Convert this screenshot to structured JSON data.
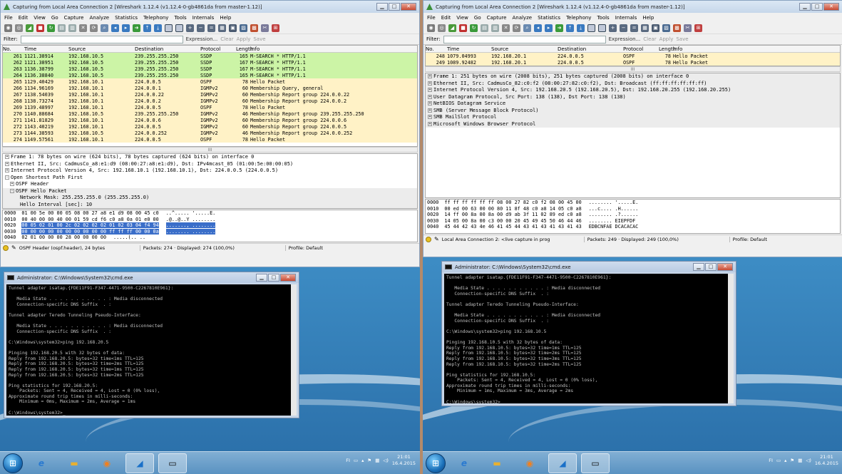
{
  "left": {
    "wireshark": {
      "title": "Capturing from Local Area Connection 2   [Wireshark 1.12.4  (v1.12.4-0-gb4861da from master-1.12)]",
      "menu": [
        "File",
        "Edit",
        "View",
        "Go",
        "Capture",
        "Analyze",
        "Statistics",
        "Telephony",
        "Tools",
        "Internals",
        "Help"
      ],
      "filter_label": "Filter:",
      "filter_actions": [
        "Expression...",
        "Clear",
        "Apply",
        "Save"
      ],
      "columns": [
        "No.",
        "Time",
        "Source",
        "Destination",
        "Protocol",
        "Length",
        "Info"
      ],
      "packets": [
        {
          "no": "261",
          "time": "1121.38914",
          "src": "192.168.10.5",
          "dst": "239.255.255.250",
          "proto": "SSDP",
          "len": "165",
          "info": "M-SEARCH * HTTP/1.1",
          "color": "#ccf4a6"
        },
        {
          "no": "262",
          "time": "1121.38951",
          "src": "192.168.10.5",
          "dst": "239.255.255.250",
          "proto": "SSDP",
          "len": "167",
          "info": "M-SEARCH * HTTP/1.1",
          "color": "#ccf4a6"
        },
        {
          "no": "263",
          "time": "1136.38799",
          "src": "192.168.10.5",
          "dst": "239.255.255.250",
          "proto": "SSDP",
          "len": "167",
          "info": "M-SEARCH * HTTP/1.1",
          "color": "#ccf4a6"
        },
        {
          "no": "264",
          "time": "1136.38840",
          "src": "192.168.10.5",
          "dst": "239.255.255.250",
          "proto": "SSDP",
          "len": "165",
          "info": "M-SEARCH * HTTP/1.1",
          "color": "#ccf4a6"
        },
        {
          "no": "265",
          "time": "1129.40429",
          "src": "192.168.10.1",
          "dst": "224.0.0.5",
          "proto": "OSPF",
          "len": "78",
          "info": "Hello Packet",
          "color": "#fff2c6"
        },
        {
          "no": "266",
          "time": "1134.96169",
          "src": "192.168.10.1",
          "dst": "224.0.0.1",
          "proto": "IGMPv2",
          "len": "60",
          "info": "Membership Query, general",
          "color": "#fff2c6"
        },
        {
          "no": "267",
          "time": "1138.54039",
          "src": "192.168.10.1",
          "dst": "224.0.0.22",
          "proto": "IGMPv2",
          "len": "60",
          "info": "Membership Report group 224.0.0.22",
          "color": "#fff2c6"
        },
        {
          "no": "268",
          "time": "1138.73274",
          "src": "192.168.10.1",
          "dst": "224.0.0.2",
          "proto": "IGMPv2",
          "len": "60",
          "info": "Membership Report group 224.0.0.2",
          "color": "#fff2c6"
        },
        {
          "no": "269",
          "time": "1139.48997",
          "src": "192.168.10.1",
          "dst": "224.0.0.5",
          "proto": "OSPF",
          "len": "78",
          "info": "Hello Packet",
          "color": "#fff2c6"
        },
        {
          "no": "270",
          "time": "1140.88684",
          "src": "192.168.10.5",
          "dst": "239.255.255.250",
          "proto": "IGMPv2",
          "len": "46",
          "info": "Membership Report group 239.255.255.250",
          "color": "#fff2c6"
        },
        {
          "no": "271",
          "time": "1141.81829",
          "src": "192.168.10.1",
          "dst": "224.0.0.6",
          "proto": "IGMPv2",
          "len": "60",
          "info": "Membership Report group 224.0.0.6",
          "color": "#fff2c6"
        },
        {
          "no": "272",
          "time": "1143.40219",
          "src": "192.168.10.1",
          "dst": "224.0.0.5",
          "proto": "IGMPv2",
          "len": "60",
          "info": "Membership Report group 224.0.0.5",
          "color": "#fff2c6"
        },
        {
          "no": "273",
          "time": "1144.38593",
          "src": "192.168.10.5",
          "dst": "224.0.0.252",
          "proto": "IGMPv2",
          "len": "46",
          "info": "Membership Report group 224.0.0.252",
          "color": "#fff2c6"
        },
        {
          "no": "274",
          "time": "1149.57561",
          "src": "192.168.10.1",
          "dst": "224.0.0.5",
          "proto": "OSPF",
          "len": "78",
          "info": "Hello Packet",
          "color": "#fff2c6"
        }
      ],
      "details": [
        {
          "text": "Frame 1: 78 bytes on wire (624 bits), 78 bytes captured (624 bits) on interface 0",
          "level": 0,
          "sign": "+"
        },
        {
          "text": "Ethernet II, Src: CadmusCo_a8:e1:d9 (08:00:27:a8:e1:d9), Dst: IPv4mcast_05 (01:00:5e:00:00:05)",
          "level": 0,
          "sign": "+"
        },
        {
          "text": "Internet Protocol Version 4, Src: 192.168.10.1 (192.168.10.1), Dst: 224.0.0.5 (224.0.0.5)",
          "level": 0,
          "sign": "+"
        },
        {
          "text": "Open Shortest Path First",
          "level": 0,
          "sign": "-"
        },
        {
          "text": "OSPF Header",
          "level": 1,
          "sign": "+"
        },
        {
          "text": "OSPF Hello Packet",
          "level": 1,
          "sign": "-"
        },
        {
          "text": "Network Mask: 255.255.255.0 (255.255.255.0)",
          "level": 2,
          "sign": ""
        },
        {
          "text": "Hello Interval [sec]: 10",
          "level": 2,
          "sign": ""
        }
      ],
      "hex": [
        {
          "off": "0000",
          "bytes": "01 00 5e 00 00 05 08 00  27 a8 e1 d9 08 00 45 c0",
          "ascii": "..^..... '.....E."
        },
        {
          "off": "0010",
          "bytes": "00 40 00 00 40 00 01 59  cd f6 c0 a8 0a 01 e0 00",
          "ascii": ".@..@..Y ........"
        },
        {
          "off": "0020",
          "bytes": "00 05 02 01 00 2c 02 02  02 02 01 02 03 04 f4 94",
          "ascii": "......., ........"
        },
        {
          "off": "0030",
          "bytes": "00 00 00 00 00 00 00 00  00 00 ff ff ff 00 00 0a",
          "ascii": "........ ........"
        },
        {
          "off": "0040",
          "bytes": "02 01 00 00 00 28 00 00  00 00",
          "ascii": ".....(.. .."
        }
      ],
      "status": {
        "field": "OSPF Header (ospf.header), 24 bytes",
        "packets": "Packets: 274 · Displayed: 274 (100,0%)",
        "profile": "Profile: Default"
      }
    },
    "cmd": {
      "title": "Administrator: C:\\Windows\\System32\\cmd.exe",
      "lines": [
        "Tunnel adapter isatap.{FDE11F91-F347-4471-9500-C2267810E961}:",
        "",
        "   Media State . . . . . . . . . . . : Media disconnected",
        "   Connection-specific DNS Suffix  . :",
        "",
        "Tunnel adapter Teredo Tunneling Pseudo-Interface:",
        "",
        "   Media State . . . . . . . . . . . : Media disconnected",
        "   Connection-specific DNS Suffix  . :",
        "",
        "C:\\Windows\\system32>ping 192.168.20.5",
        "",
        "Pinging 192.168.20.5 with 32 bytes of data:",
        "Reply from 192.168.20.5: bytes=32 time<1ms TTL=125",
        "Reply from 192.168.20.5: bytes=32 time=2ms TTL=125",
        "Reply from 192.168.20.5: bytes=32 time=1ms TTL=125",
        "Reply from 192.168.20.5: bytes=32 time=2ms TTL=125",
        "",
        "Ping statistics for 192.168.20.5:",
        "    Packets: Sent = 4, Received = 4, Lost = 0 (0% loss),",
        "Approximate round trip times in milli-seconds:",
        "    Minimum = 0ms, Maximum = 2ms, Average = 1ms",
        "",
        "C:\\Windows\\system32>_"
      ]
    },
    "clock": {
      "time": "21:01",
      "date": "16.4.2015"
    },
    "lang": "FI"
  },
  "right": {
    "wireshark": {
      "title": "Capturing from Local Area Connection 2   [Wireshark 1.12.4  (v1.12.4-0-gb4861da from master-1.12)]",
      "menu": [
        "File",
        "Edit",
        "View",
        "Go",
        "Capture",
        "Analyze",
        "Statistics",
        "Telephony",
        "Tools",
        "Internals",
        "Help"
      ],
      "filter_label": "Filter:",
      "filter_actions": [
        "Expression...",
        "Clear",
        "Apply",
        "Save"
      ],
      "columns": [
        "No.",
        "Time",
        "Source",
        "Destination",
        "Protocol",
        "Length",
        "Info"
      ],
      "packets": [
        {
          "no": "248",
          "time": "1079.04993",
          "src": "192.168.20.1",
          "dst": "224.0.0.5",
          "proto": "OSPF",
          "len": "78",
          "info": "Hello Packet",
          "color": "#fff2c6"
        },
        {
          "no": "249",
          "time": "1089.92482",
          "src": "192.168.20.1",
          "dst": "224.0.0.5",
          "proto": "OSPF",
          "len": "78",
          "info": "Hello Packet",
          "color": "#fff2c6"
        }
      ],
      "details": [
        {
          "text": "Frame 1: 251 bytes on wire (2008 bits), 251 bytes captured (2008 bits) on interface 0",
          "level": 0,
          "sign": "+"
        },
        {
          "text": "Ethernet II, Src: CadmusCo_82:c0:f2 (08:00:27:82:c0:f2), Dst: Broadcast (ff:ff:ff:ff:ff:ff)",
          "level": 0,
          "sign": "+"
        },
        {
          "text": "Internet Protocol Version 4, Src: 192.168.20.5 (192.168.20.5), Dst: 192.168.20.255 (192.168.20.255)",
          "level": 0,
          "sign": "+"
        },
        {
          "text": "User Datagram Protocol, Src Port: 138 (138), Dst Port: 138 (138)",
          "level": 0,
          "sign": "+"
        },
        {
          "text": "NetBIOS Datagram Service",
          "level": 0,
          "sign": "+"
        },
        {
          "text": "SMB (Server Message Block Protocol)",
          "level": 0,
          "sign": "+"
        },
        {
          "text": "SMB MailSlot Protocol",
          "level": 0,
          "sign": "+"
        },
        {
          "text": "Microsoft Windows Browser Protocol",
          "level": 0,
          "sign": "+"
        }
      ],
      "hex": [
        {
          "off": "0000",
          "bytes": "ff ff ff ff ff ff 08 00  27 82 c0 f2 08 00 45 00",
          "ascii": "........ '.....E."
        },
        {
          "off": "0010",
          "bytes": "00 ed 00 63 00 00 80 11  8f 48 c0 a8 14 05 c0 a8",
          "ascii": "...c.... .H......"
        },
        {
          "off": "0020",
          "bytes": "14 ff 00 8a 00 8a 00 d9  ab 3f 11 02 89 ed c0 a8",
          "ascii": "........ .?......"
        },
        {
          "off": "0030",
          "bytes": "14 05 00 8a 00 c3 00 00  20 45 49 45 50 46 44 46",
          "ascii": "........  EIEPFDF"
        },
        {
          "off": "0040",
          "bytes": "45 44 42 43 4e 46 41 45  44 43 41 43 41 43 41 43",
          "ascii": "EDBCNFAE DCACACAC"
        }
      ],
      "status": {
        "field": "Local Area Connection 2: <live capture in prog",
        "packets": "Packets: 249 · Displayed: 249 (100,0%)",
        "profile": "Profile: Default"
      }
    },
    "cmd": {
      "title": "Administrator: C:\\Windows\\System32\\cmd.exe",
      "lines": [
        "Tunnel adapter isatap.{FDE11F91-F347-4471-9500-C2267810E961}:",
        "",
        "   Media State . . . . . . . . . . . : Media disconnected",
        "   Connection-specific DNS Suffix  . :",
        "",
        "Tunnel adapter Teredo Tunneling Pseudo-Interface:",
        "",
        "   Media State . . . . . . . . . . . : Media disconnected",
        "   Connection-specific DNS Suffix  . :",
        "",
        "C:\\Windows\\system32>ping 192.168.10.5",
        "",
        "Pinging 192.168.10.5 with 32 bytes of data:",
        "Reply from 192.168.10.5: bytes=32 time=1ms TTL=125",
        "Reply from 192.168.10.5: bytes=32 time=2ms TTL=125",
        "Reply from 192.168.10.5: bytes=32 time=3ms TTL=125",
        "Reply from 192.168.10.5: bytes=32 time=2ms TTL=125",
        "",
        "Ping statistics for 192.168.10.5:",
        "    Packets: Sent = 4, Received = 4, Lost = 0 (0% loss),",
        "Approximate round trip times in milli-seconds:",
        "    Minimum = 1ms, Maximum = 3ms, Average = 2ms",
        "",
        "C:\\Windows\\system32>_"
      ]
    },
    "clock": {
      "time": "21:01",
      "date": "16.4.2015"
    },
    "lang": "FI"
  },
  "colors": {
    "ssdp_row": "#ccf4a6",
    "igmp_row": "#fff2c6",
    "selected_hex": "#3a6ec9"
  }
}
